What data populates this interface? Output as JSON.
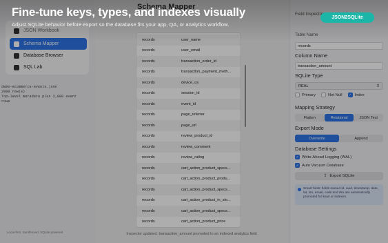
{
  "banner": {
    "headline": "Fine-tune keys, types, and indexes visually",
    "subline": "Adjust SQLite behavior before export so the database fits your app, QA, or analytics workflow.",
    "badge": "JSON2SQLite"
  },
  "sidebar": {
    "app_name": "JSON2SQLite",
    "items": [
      {
        "label": "JSON Workbook",
        "icon": "document-icon"
      },
      {
        "label": "Schema Mapper",
        "icon": "table-icon"
      },
      {
        "label": "Database Browser",
        "icon": "database-icon"
      },
      {
        "label": "SQL Lab",
        "icon": "terminal-icon"
      }
    ],
    "info_lines": [
      "demo-ecommerce-events.json",
      "2000 row(s)",
      "Top-level metadata plus 2,000 event",
      "rows"
    ],
    "footer": "Local-first. Sandboxed. SQLite powered."
  },
  "center": {
    "title": "Schema Mapper",
    "rows": [
      {
        "table": "records",
        "column": "user_name"
      },
      {
        "table": "records",
        "column": "user_email"
      },
      {
        "table": "records",
        "column": "transaction_order_id"
      },
      {
        "table": "records",
        "column": "transaction_payment_meth..."
      },
      {
        "table": "records",
        "column": "device_os"
      },
      {
        "table": "records",
        "column": "session_id"
      },
      {
        "table": "records",
        "column": "event_id"
      },
      {
        "table": "records",
        "column": "page_referrer"
      },
      {
        "table": "records",
        "column": "page_url"
      },
      {
        "table": "records",
        "column": "review_product_id"
      },
      {
        "table": "records",
        "column": "review_comment"
      },
      {
        "table": "records",
        "column": "review_rating"
      },
      {
        "table": "records",
        "column": "cart_action_product_specs..."
      },
      {
        "table": "records",
        "column": "cart_action_product_produ..."
      },
      {
        "table": "records",
        "column": "cart_action_product_specs..."
      },
      {
        "table": "records",
        "column": "cart_action_product_in_sto..."
      },
      {
        "table": "records",
        "column": "cart_action_product_specs..."
      },
      {
        "table": "records",
        "column": "cart_action_product_price"
      }
    ],
    "status": "Inspector updated. transaction_amount promoted to an indexed analytics field"
  },
  "inspector": {
    "field_inspector_label": "Field Inspector",
    "table_name_label": "Table Name",
    "table_name_value": "records",
    "column_name_label": "Column Name",
    "column_name_value": "transaction_amount",
    "sqlite_type_label": "SQLite Type",
    "sqlite_type_value": "REAL",
    "checks": [
      {
        "label": "Primary",
        "checked": false
      },
      {
        "label": "Not Null",
        "checked": false
      },
      {
        "label": "Index",
        "checked": true
      }
    ],
    "mapping_label": "Mapping Strategy",
    "mapping_options": [
      "Flatten",
      "Relational",
      "JSON Text"
    ],
    "mapping_selected": "Relational",
    "export_mode_label": "Export Mode",
    "export_options": [
      "Overwrite",
      "Append"
    ],
    "export_selected": "Overwrite",
    "db_settings_label": "Database Settings",
    "db_settings": [
      {
        "label": "Write-Ahead Logging (WAL)",
        "checked": true
      },
      {
        "label": "Auto Vacuum Database",
        "checked": true
      }
    ],
    "export_button": "Export SQLite",
    "hint": "Smart hints: fields named id, uuid, timestamp, date, lat, lon, email, code and sku are automatically promoted for keys or indexes."
  },
  "colors": {
    "accent": "#2d74e6",
    "badge": "#1bb6a8"
  }
}
